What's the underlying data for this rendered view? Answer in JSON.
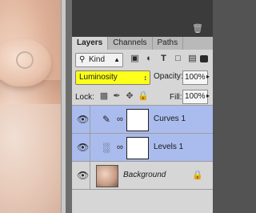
{
  "panel": {
    "tabs": [
      {
        "label": "Layers",
        "active": true
      },
      {
        "label": "Channels",
        "active": false
      },
      {
        "label": "Paths",
        "active": false
      }
    ],
    "filter": {
      "kind_label": "Kind",
      "icons": [
        "image-filter-icon",
        "adjustment-filter-icon",
        "type-filter-icon",
        "shape-filter-icon",
        "smart-object-filter-icon"
      ]
    },
    "blend_mode": "Luminosity",
    "opacity_label": "Opacity:",
    "opacity_value": "100%",
    "lock_label": "Lock:",
    "fill_label": "Fill:",
    "fill_value": "100%",
    "layers": [
      {
        "name": "Curves 1",
        "type": "curves",
        "selected": true
      },
      {
        "name": "Levels 1",
        "type": "levels",
        "selected": true
      },
      {
        "name": "Background",
        "type": "image",
        "selected": false,
        "locked": true
      }
    ]
  },
  "colors": {
    "highlight": "#fbff1a",
    "selection": "#aabbed",
    "panel_bg": "#d6d6d6"
  }
}
